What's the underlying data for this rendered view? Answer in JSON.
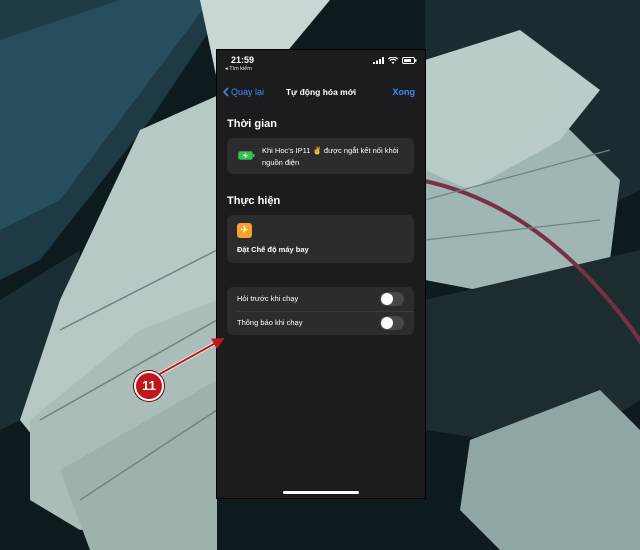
{
  "status_bar": {
    "time": "21:59",
    "back_app_label": "◂ Tìm kiếm"
  },
  "nav": {
    "back_label": "Quay lại",
    "title": "Tự động hóa mới",
    "done_label": "Xong"
  },
  "trigger_section": {
    "title": "Thời gian",
    "text": "Khi Hoc's IP11 ✌️ được ngắt kết nối khỏi nguồn điện"
  },
  "action_section": {
    "title": "Thực hiện",
    "action_icon": "airplane-icon",
    "action_label": "Đặt Chế độ máy bay"
  },
  "settings": [
    {
      "label": "Hỏi trước khi chạy",
      "enabled": false
    },
    {
      "label": "Thông báo khi chạy",
      "enabled": false
    }
  ],
  "annotation": {
    "step_number": "11",
    "color": "#c0171c"
  },
  "colors": {
    "accent": "#3a8df5",
    "background": "#1c1c1e",
    "card": "#2c2c2e",
    "action_icon_bg": "#f4a32e"
  }
}
